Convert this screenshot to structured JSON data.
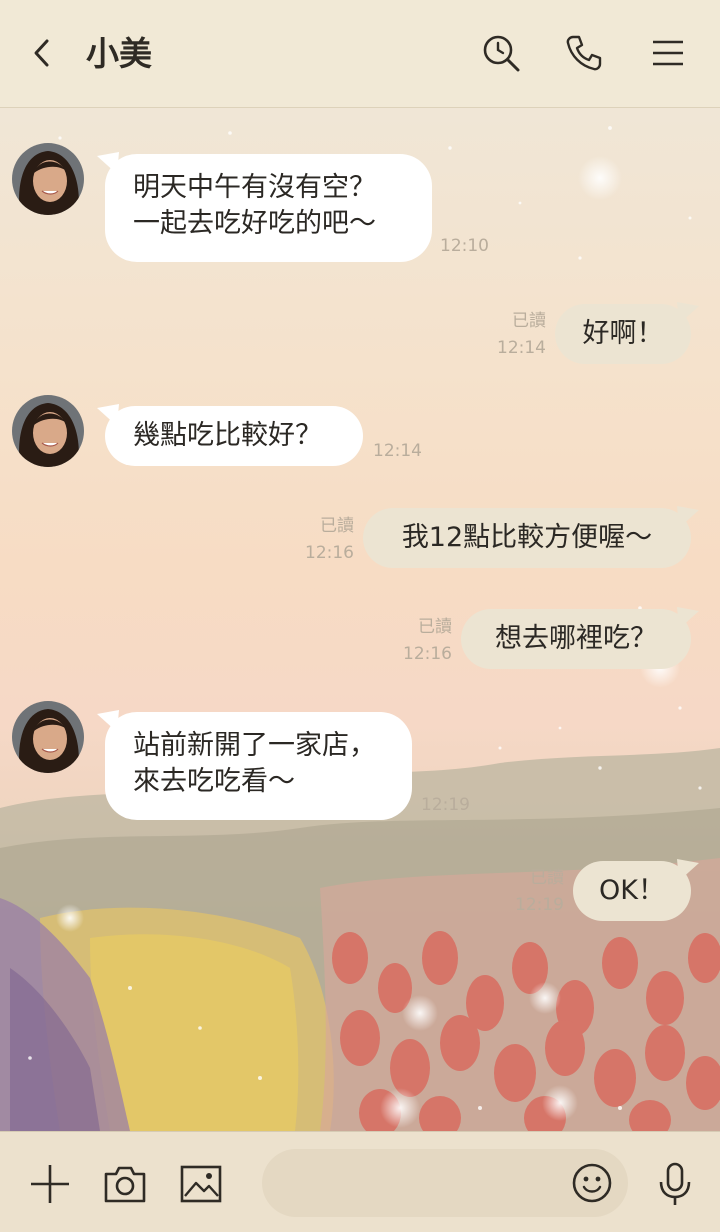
{
  "header": {
    "title": "小美",
    "icons": [
      "back-icon",
      "search-icon",
      "phone-icon",
      "menu-icon"
    ]
  },
  "messages": [
    {
      "side": "in",
      "line1": "明天中午有沒有空？",
      "line2": "一起去吃好吃的吧～",
      "time": "12:10"
    },
    {
      "side": "out",
      "text": "好啊！",
      "read": "已讀",
      "time": "12:14"
    },
    {
      "side": "in",
      "text": "幾點吃比較好？",
      "time": "12:14"
    },
    {
      "side": "out",
      "text": "我12點比較方便喔～",
      "read": "已讀",
      "time": "12:16"
    },
    {
      "side": "out",
      "text": "想去哪裡吃？",
      "read": "已讀",
      "time": "12:16"
    },
    {
      "side": "in",
      "line1": "站前新開了一家店，",
      "line2": "來去吃吃看～",
      "time": "12:19"
    },
    {
      "side": "out",
      "text": "OK！",
      "read": "已讀",
      "time": "12:19"
    }
  ],
  "footer": {
    "icons": [
      "plus-icon",
      "camera-icon",
      "image-icon",
      "emoji-icon",
      "microphone-icon"
    ],
    "input_placeholder": ""
  },
  "colors": {
    "header_bg": "#f1e9d6",
    "bubble_in": "#ffffff",
    "bubble_out": "#ece4d2",
    "footer_bg": "#ece1cd",
    "meta_text": "#b9ad9c"
  }
}
